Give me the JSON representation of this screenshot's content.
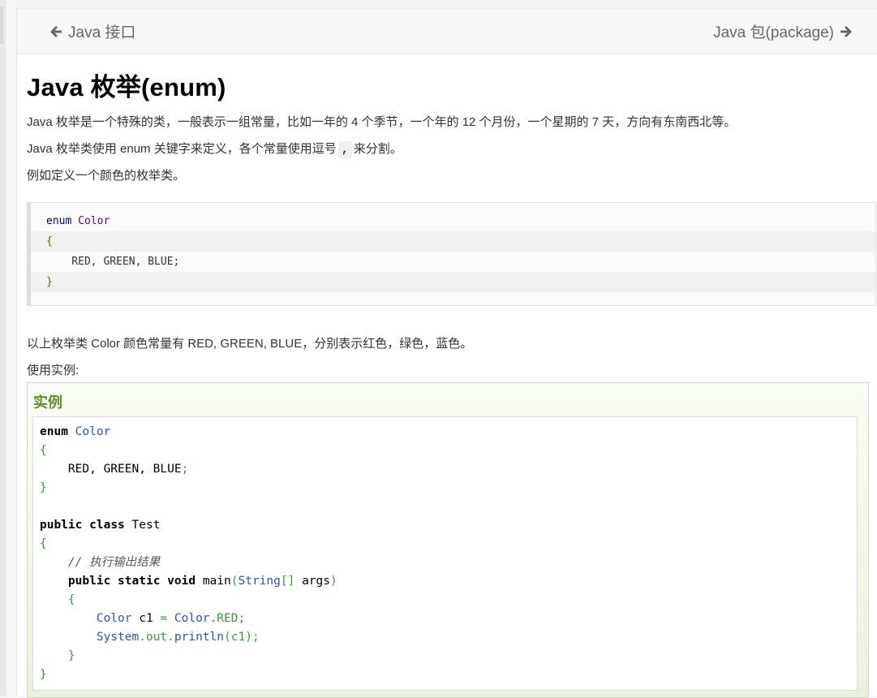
{
  "nav": {
    "prev_label": "Java 接口",
    "next_label": "Java 包(package)"
  },
  "article": {
    "title": "Java 枚举(enum)",
    "intro": "Java 枚举是一个特殊的类，一般表示一组常量，比如一年的 4 个季节，一个年的 12 个月份，一个星期的 7 天，方向有东南西北等。",
    "keyword_text_before": "Java 枚举类使用 enum 关键字来定义，各个常量使用逗号",
    "keyword_inline_code": ",",
    "keyword_text_after": "来分割。",
    "example_intro": "例如定义一个颜色的枚举类。",
    "constants_note": "以上枚举类 Color 颜色常量有 RED, GREEN, BLUE，分别表示红色，绿色，蓝色。",
    "usage_label": "使用实例:"
  },
  "code_block_1": {
    "kw_enum": "enum",
    "type_color": "Color",
    "open_brace": "{",
    "constants": "    RED, GREEN, BLUE;",
    "close_brace": "}"
  },
  "example": {
    "title": "实例",
    "kw_enum": "enum",
    "t_color": "Color",
    "brace_open": "{",
    "constants": "RED, GREEN, BLUE",
    "semicolon": ";",
    "brace_close": "}",
    "kw_public": "public",
    "kw_class": "class",
    "class_name": "Test",
    "comment": "// 执行输出结果",
    "kw_static": "static",
    "kw_void": "void",
    "method_name": "main",
    "paren_open": "(",
    "t_string": "String",
    "brackets": "[]",
    "args": " args",
    "paren_close": ")",
    "c1_decl": " c1 ",
    "equals": "=",
    "t_color_ref": " Color",
    "dot_red": ".RED;",
    "system": "System",
    "dot_out": ".out.",
    "println": "println",
    "call_args": "(c1);"
  },
  "colors": {
    "accent_green": "#5f8f2c",
    "keyword_blue": "#2a52be",
    "punct_green": "#3a9a3a"
  }
}
